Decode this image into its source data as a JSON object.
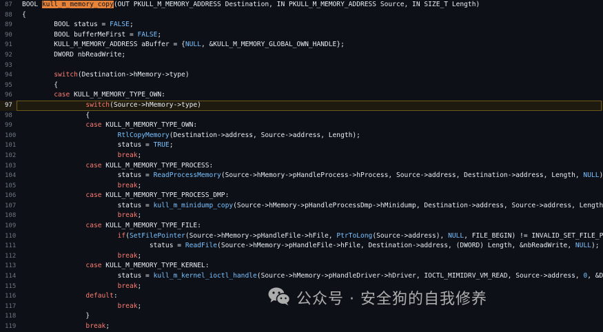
{
  "editor": {
    "active_line": "97",
    "lines": [
      {
        "num": "87",
        "tokens": [
          {
            "t": "BOOL "
          },
          {
            "t": "kull_m_memory_copy",
            "c": "hl"
          },
          {
            "t": "(OUT PKULL_M_MEMORY_ADDRESS Destination, IN PKULL_M_MEMORY_ADDRESS Source, IN SIZE_T Length)"
          }
        ]
      },
      {
        "num": "88",
        "tokens": [
          {
            "t": "{"
          }
        ]
      },
      {
        "num": "89",
        "tokens": [
          {
            "t": "        BOOL status = "
          },
          {
            "t": "FALSE",
            "c": "cst"
          },
          {
            "t": ";"
          }
        ]
      },
      {
        "num": "90",
        "tokens": [
          {
            "t": "        BOOL bufferMeFirst = "
          },
          {
            "t": "FALSE",
            "c": "cst"
          },
          {
            "t": ";"
          }
        ]
      },
      {
        "num": "91",
        "tokens": [
          {
            "t": "        KULL_M_MEMORY_ADDRESS aBuffer = {"
          },
          {
            "t": "NULL",
            "c": "cst"
          },
          {
            "t": ", &KULL_M_MEMORY_GLOBAL_OWN_HANDLE};"
          }
        ]
      },
      {
        "num": "92",
        "tokens": [
          {
            "t": "        DWORD nbReadWrite;"
          }
        ]
      },
      {
        "num": "93",
        "tokens": [
          {
            "t": ""
          }
        ]
      },
      {
        "num": "94",
        "tokens": [
          {
            "t": "        "
          },
          {
            "t": "switch",
            "c": "kw"
          },
          {
            "t": "(Destination->hMemory->type)"
          }
        ]
      },
      {
        "num": "95",
        "tokens": [
          {
            "t": "        {"
          }
        ]
      },
      {
        "num": "96",
        "tokens": [
          {
            "t": "        "
          },
          {
            "t": "case",
            "c": "kw"
          },
          {
            "t": " KULL_M_MEMORY_TYPE_OWN:"
          }
        ]
      },
      {
        "num": "97",
        "tokens": [
          {
            "t": "                "
          },
          {
            "t": "switch",
            "c": "kw"
          },
          {
            "t": "(Source->hMemory->type)"
          }
        ]
      },
      {
        "num": "98",
        "tokens": [
          {
            "t": "                {"
          }
        ]
      },
      {
        "num": "99",
        "tokens": [
          {
            "t": "                "
          },
          {
            "t": "case",
            "c": "kw"
          },
          {
            "t": " KULL_M_MEMORY_TYPE_OWN:"
          }
        ]
      },
      {
        "num": "100",
        "tokens": [
          {
            "t": "                        "
          },
          {
            "t": "RtlCopyMemory",
            "c": "fn"
          },
          {
            "t": "(Destination->address, Source->address, Length);"
          }
        ]
      },
      {
        "num": "101",
        "tokens": [
          {
            "t": "                        status = "
          },
          {
            "t": "TRUE",
            "c": "cst"
          },
          {
            "t": ";"
          }
        ]
      },
      {
        "num": "102",
        "tokens": [
          {
            "t": "                        "
          },
          {
            "t": "break",
            "c": "kw"
          },
          {
            "t": ";"
          }
        ]
      },
      {
        "num": "103",
        "tokens": [
          {
            "t": "                "
          },
          {
            "t": "case",
            "c": "kw"
          },
          {
            "t": " KULL_M_MEMORY_TYPE_PROCESS:"
          }
        ]
      },
      {
        "num": "104",
        "tokens": [
          {
            "t": "                        status = "
          },
          {
            "t": "ReadProcessMemory",
            "c": "fn"
          },
          {
            "t": "(Source->hMemory->pHandleProcess->hProcess, Source->address, Destination->address, Length, "
          },
          {
            "t": "NULL",
            "c": "cst"
          },
          {
            "t": ");"
          }
        ]
      },
      {
        "num": "105",
        "tokens": [
          {
            "t": "                        "
          },
          {
            "t": "break",
            "c": "kw"
          },
          {
            "t": ";"
          }
        ]
      },
      {
        "num": "106",
        "tokens": [
          {
            "t": "                "
          },
          {
            "t": "case",
            "c": "kw"
          },
          {
            "t": " KULL_M_MEMORY_TYPE_PROCESS_DMP:"
          }
        ]
      },
      {
        "num": "107",
        "tokens": [
          {
            "t": "                        status = "
          },
          {
            "t": "kull_m_minidump_copy",
            "c": "fn"
          },
          {
            "t": "(Source->hMemory->pHandleProcessDmp->hMinidump, Destination->address, Source->address, Length);"
          }
        ]
      },
      {
        "num": "108",
        "tokens": [
          {
            "t": "                        "
          },
          {
            "t": "break",
            "c": "kw"
          },
          {
            "t": ";"
          }
        ]
      },
      {
        "num": "109",
        "tokens": [
          {
            "t": "                "
          },
          {
            "t": "case",
            "c": "kw"
          },
          {
            "t": " KULL_M_MEMORY_TYPE_FILE:"
          }
        ]
      },
      {
        "num": "110",
        "tokens": [
          {
            "t": "                        "
          },
          {
            "t": "if",
            "c": "kw"
          },
          {
            "t": "("
          },
          {
            "t": "SetFilePointer",
            "c": "fn"
          },
          {
            "t": "(Source->hMemory->pHandleFile->hFile, "
          },
          {
            "t": "PtrToLong",
            "c": "fn"
          },
          {
            "t": "(Source->address), "
          },
          {
            "t": "NULL",
            "c": "cst"
          },
          {
            "t": ", FILE_BEGIN) != INVALID_SET_FILE_POINTER)"
          }
        ]
      },
      {
        "num": "111",
        "tokens": [
          {
            "t": "                                status = "
          },
          {
            "t": "ReadFile",
            "c": "fn"
          },
          {
            "t": "(Source->hMemory->pHandleFile->hFile, Destination->address, (DWORD) Length, &nbReadWrite, "
          },
          {
            "t": "NULL",
            "c": "cst"
          },
          {
            "t": ");"
          }
        ]
      },
      {
        "num": "112",
        "tokens": [
          {
            "t": "                        "
          },
          {
            "t": "break",
            "c": "kw"
          },
          {
            "t": ";"
          }
        ]
      },
      {
        "num": "113",
        "tokens": [
          {
            "t": "                "
          },
          {
            "t": "case",
            "c": "kw"
          },
          {
            "t": " KULL_M_MEMORY_TYPE_KERNEL:"
          }
        ]
      },
      {
        "num": "114",
        "tokens": [
          {
            "t": "                        status = "
          },
          {
            "t": "kull_m_kernel_ioctl_handle",
            "c": "fn"
          },
          {
            "t": "(Source->hMemory->pHandleDriver->hDriver, IOCTL_MIMIDRV_VM_READ, Source->address, "
          },
          {
            "t": "0",
            "c": "num"
          },
          {
            "t": ", &Destination->ac"
          }
        ]
      },
      {
        "num": "115",
        "tokens": [
          {
            "t": "                        "
          },
          {
            "t": "break",
            "c": "kw"
          },
          {
            "t": ";"
          }
        ]
      },
      {
        "num": "116",
        "tokens": [
          {
            "t": "                "
          },
          {
            "t": "default",
            "c": "kw"
          },
          {
            "t": ":"
          }
        ]
      },
      {
        "num": "117",
        "tokens": [
          {
            "t": "                        "
          },
          {
            "t": "break",
            "c": "kw"
          },
          {
            "t": ";"
          }
        ]
      },
      {
        "num": "118",
        "tokens": [
          {
            "t": "                }"
          }
        ]
      },
      {
        "num": "119",
        "tokens": [
          {
            "t": "                "
          },
          {
            "t": "break",
            "c": "kw"
          },
          {
            "t": ";"
          }
        ]
      }
    ]
  },
  "watermark": {
    "text": "公众号 · 安全狗的自我修养",
    "icon": "wechat-icon"
  }
}
